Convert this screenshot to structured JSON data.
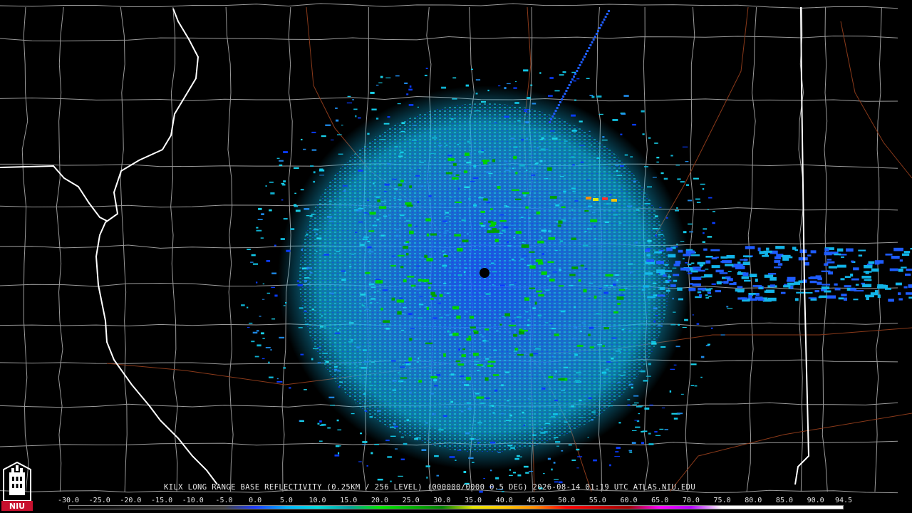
{
  "product": {
    "caption": "KILX LONG RANGE BASE REFLECTIVITY (0.25KM / 256 LEVEL) (000000/0000 0.5 DEG) 2026-08-14 01:19 UTC  ATLAS.NIU.EDU"
  },
  "logo": {
    "text": "NIU",
    "colors": {
      "red": "#c8102e",
      "white": "#ffffff"
    }
  },
  "legend": {
    "labels": [
      "-30.0",
      "-25.0",
      "-20.0",
      "-15.0",
      "-10.0",
      "-5.0",
      "0.0",
      "5.0",
      "10.0",
      "15.0",
      "20.0",
      "25.0",
      "30.0",
      "35.0",
      "40.0",
      "45.0",
      "50.0",
      "55.0",
      "60.0",
      "65.0",
      "70.0",
      "75.0",
      "80.0",
      "85.0",
      "90.0",
      "94.5"
    ],
    "min": -30.0,
    "max": 94.5,
    "color_stops": [
      {
        "value": -30,
        "color": "#000000"
      },
      {
        "value": -5,
        "color": "#404040"
      },
      {
        "value": 0,
        "color": "#1e3cff"
      },
      {
        "value": 5,
        "color": "#00b4ff"
      },
      {
        "value": 10,
        "color": "#00dcdc"
      },
      {
        "value": 15,
        "color": "#00a0a0"
      },
      {
        "value": 20,
        "color": "#00e600"
      },
      {
        "value": 25,
        "color": "#00b400"
      },
      {
        "value": 30,
        "color": "#008200"
      },
      {
        "value": 35,
        "color": "#e6e600"
      },
      {
        "value": 40,
        "color": "#ffc800"
      },
      {
        "value": 45,
        "color": "#ff8c00"
      },
      {
        "value": 50,
        "color": "#ff0000"
      },
      {
        "value": 55,
        "color": "#d20000"
      },
      {
        "value": 60,
        "color": "#a00000"
      },
      {
        "value": 65,
        "color": "#ff00ff"
      },
      {
        "value": 70,
        "color": "#b400ff"
      },
      {
        "value": 75,
        "color": "#ffffff"
      },
      {
        "value": 94.5,
        "color": "#ffffff"
      }
    ]
  },
  "map": {
    "background": "#000000",
    "county_color": "#9a9a9a",
    "state_color": "#ffffff",
    "highway_color": "#8b3a1a",
    "radar_site": "KILX"
  }
}
